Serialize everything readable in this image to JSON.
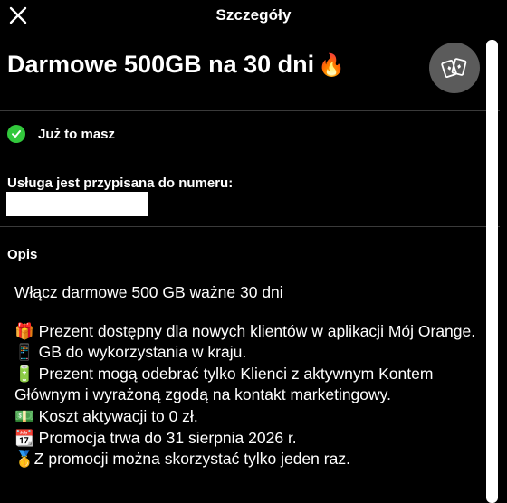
{
  "header": {
    "title": "Szczegóły"
  },
  "offer": {
    "title": "Darmowe 500GB na 30 dni",
    "title_emoji": "🔥"
  },
  "status": {
    "text": "Już to masz"
  },
  "assignment": {
    "label": "Usługa jest przypisana do numeru:",
    "number": ""
  },
  "description": {
    "label": "Opis",
    "headline": "Włącz darmowe 500 GB ważne 30 dni",
    "lines": [
      "🎁 Prezent dostępny dla nowych klientów w aplikacji Mój Orange.",
      "📱 GB do wykorzystania w kraju.",
      "🔋 Prezent mogą odebrać tylko Klienci z aktywnym Kontem Głównym i wyrażoną zgodą na kontakt marketingowy.",
      "💵 Koszt aktywacji to 0 zł.",
      "📆 Promocja trwa do 31 sierpnia 2026 r.",
      "🥇Z promocji można skorzystać tylko jeden raz."
    ]
  },
  "icons": {
    "close": "close-icon",
    "action": "cards-icon",
    "status": "check-circle-icon"
  },
  "colors": {
    "background": "#000000",
    "accent_green": "#32c83c",
    "action_circle": "#5b5b5b"
  }
}
